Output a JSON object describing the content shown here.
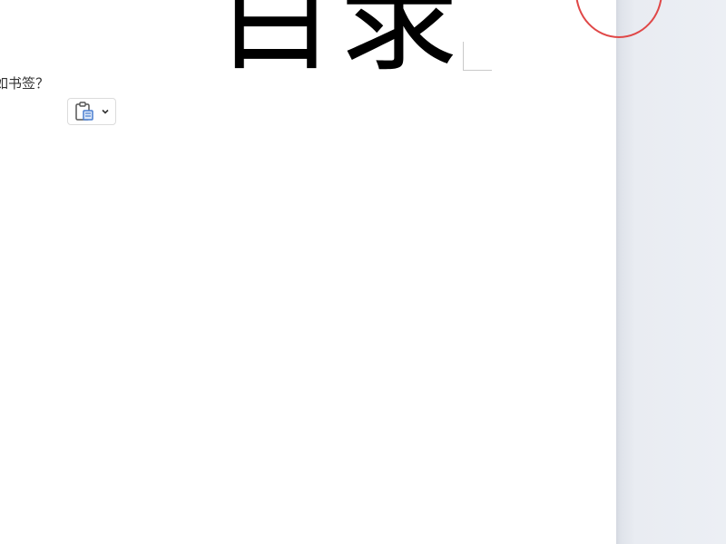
{
  "document": {
    "heading": "目录",
    "bookmark_question": "如书签？"
  },
  "paste_options": {
    "icon": "clipboard-icon",
    "dropdown_icon": "chevron-down-icon"
  },
  "annotation": {
    "color": "#e04848",
    "shape": "circle"
  },
  "colors": {
    "page": "#ffffff",
    "workspace": "#e9ecf2",
    "text": "#000000",
    "accent_icon": "#4a7fd0"
  }
}
